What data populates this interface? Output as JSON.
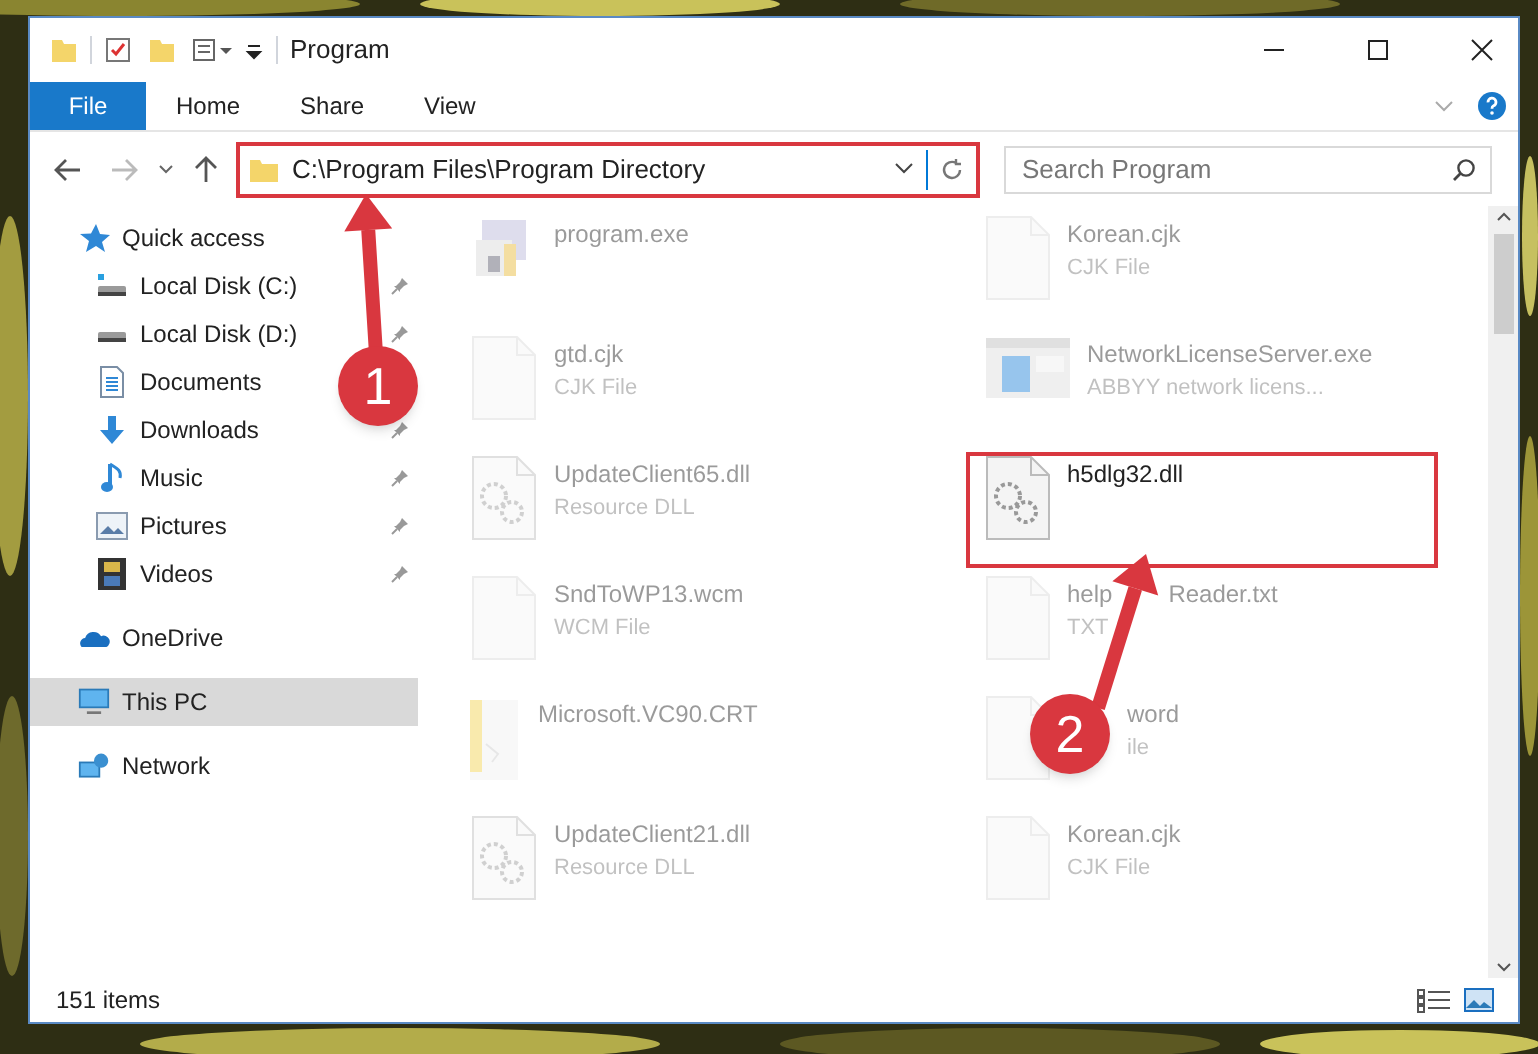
{
  "window": {
    "title": "Program"
  },
  "ribbon_tabs": [
    {
      "label": "File",
      "selected": true
    },
    {
      "label": "Home",
      "selected": false
    },
    {
      "label": "Share",
      "selected": false
    },
    {
      "label": "View",
      "selected": false
    }
  ],
  "address_bar": {
    "path": "C:\\Program Files\\Program Directory",
    "highlighted": true
  },
  "search": {
    "placeholder": "Search Program"
  },
  "sidebar": {
    "items": [
      {
        "label": "Quick access",
        "kind": "star",
        "selected": false,
        "children": [
          {
            "label": "Local Disk (C:)",
            "kind": "drive-c",
            "pinned": true,
            "selected": false
          },
          {
            "label": "Local Disk (D:)",
            "kind": "drive",
            "pinned": true,
            "selected": false
          },
          {
            "label": "Documents",
            "kind": "documents",
            "selected": false
          },
          {
            "label": "Downloads",
            "kind": "downloads",
            "pinned": true,
            "selected": false
          },
          {
            "label": "Music",
            "kind": "music",
            "pinned": true,
            "selected": false
          },
          {
            "label": "Pictures",
            "kind": "pictures",
            "pinned": true,
            "selected": false
          },
          {
            "label": "Videos",
            "kind": "videos",
            "pinned": true,
            "selected": false
          }
        ]
      },
      {
        "label": "OneDrive",
        "kind": "cloud",
        "selected": false
      },
      {
        "label": "This PC",
        "kind": "pc",
        "selected": true
      },
      {
        "label": "Network",
        "kind": "network",
        "selected": false
      }
    ]
  },
  "files": [
    {
      "name": "program.exe",
      "kind": "app",
      "highlighted": false
    },
    {
      "name": "Korean.cjk",
      "type": "CJK File",
      "kind": "blank",
      "highlighted": false
    },
    {
      "name": "gtd.cjk",
      "type": "CJK File",
      "kind": "blank",
      "highlighted": false
    },
    {
      "name": "NetworkLicenseServer.exe",
      "type": "ABBYY network licens...",
      "kind": "window",
      "highlighted": false
    },
    {
      "name": "UpdateClient65.dll",
      "type": "Resource DLL",
      "kind": "gear",
      "highlighted": false
    },
    {
      "name": "h5dlg32.dll",
      "kind": "gear",
      "highlighted": true
    },
    {
      "name": "SndToWP13.wcm",
      "type": "WCM File",
      "kind": "blank",
      "highlighted": false
    },
    {
      "name": "help",
      "name_end": "Reader.txt",
      "type": "TXT",
      "kind": "blank",
      "highlighted": false
    },
    {
      "name": "Microsoft.VC90.CRT",
      "kind": "folder",
      "highlighted": false
    },
    {
      "name": "word",
      "type": "ile",
      "kind": "blank",
      "highlighted": false
    },
    {
      "name": "UpdateClient21.dll",
      "type": "Resource DLL",
      "kind": "gear",
      "highlighted": false
    },
    {
      "name": "Korean.cjk",
      "type": "CJK File",
      "kind": "blank",
      "highlighted": false
    }
  ],
  "status_bar": {
    "count": "151 items"
  },
  "annotations": [
    {
      "number": "1"
    },
    {
      "number": "2"
    }
  ]
}
